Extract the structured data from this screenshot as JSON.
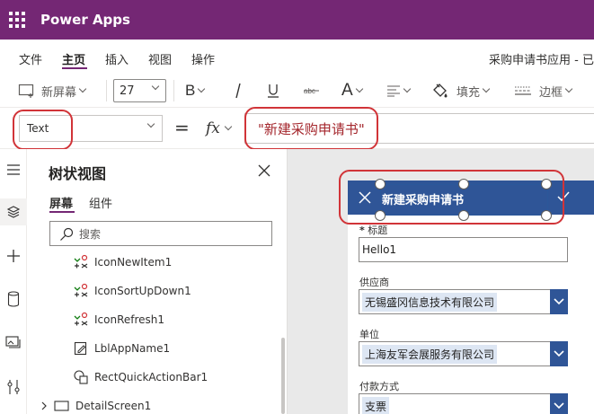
{
  "app": {
    "name": "Power Apps"
  },
  "menu": {
    "items": [
      "文件",
      "主页",
      "插入",
      "视图",
      "操作"
    ],
    "active_index": 1,
    "doc_title": "采购申请书应用 - 已"
  },
  "toolbar": {
    "new_screen_label": "新屏幕",
    "font_size": "27",
    "fill_label": "填充",
    "border_label": "边框"
  },
  "formula": {
    "property": "Text",
    "equals": "=",
    "fx_label": "fx",
    "expression": "\"新建采购申请书\""
  },
  "tree": {
    "title": "树状视图",
    "tabs": [
      "屏幕",
      "组件"
    ],
    "active_tab": 0,
    "search_placeholder": "搜索",
    "items": [
      {
        "label": "IconNewItem1",
        "icon": "icon-control-icon"
      },
      {
        "label": "IconSortUpDown1",
        "icon": "icon-control-icon"
      },
      {
        "label": "IconRefresh1",
        "icon": "icon-control-icon"
      },
      {
        "label": "LblAppName1",
        "icon": "label-edit-icon"
      },
      {
        "label": "RectQuickActionBar1",
        "icon": "rectangle-shape-icon"
      }
    ],
    "screen_item": {
      "label": "DetailScreen1",
      "icon": "screen-icon"
    }
  },
  "canvas": {
    "header_title": "新建采购申请书",
    "fields": {
      "title": {
        "label": "标题",
        "required_mark": "*",
        "value": "Hello1"
      },
      "supplier": {
        "label": "供应商",
        "value": "无锡盛冈信息技术有限公司"
      },
      "unit": {
        "label": "单位",
        "value": "上海友军会展服务有限公司"
      },
      "payment": {
        "label": "付款方式",
        "value": "支票"
      }
    }
  },
  "colors": {
    "app_bar": "#742774",
    "header_bar": "#2f5597",
    "annotation_ring": "#d13438",
    "formula_text": "#a4262c"
  }
}
